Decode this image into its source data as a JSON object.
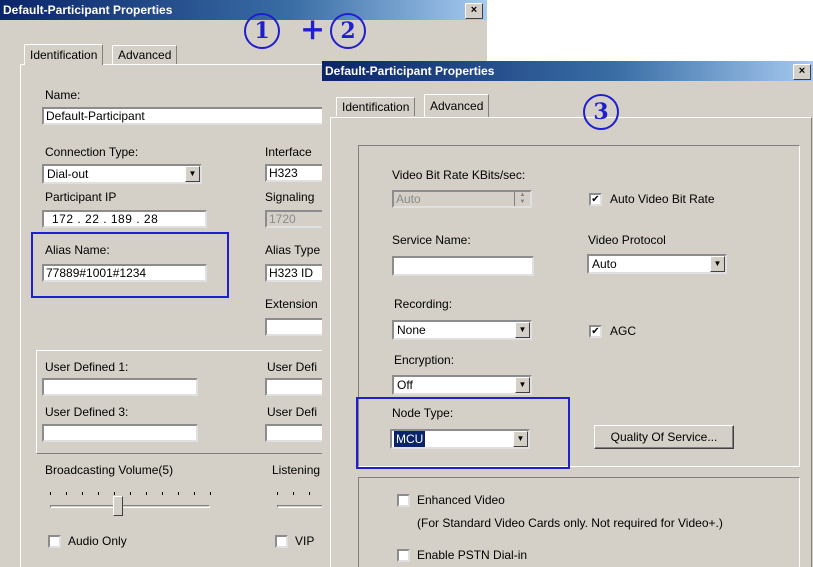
{
  "annotations": {
    "step1": "1",
    "plus": "+",
    "step2": "2",
    "step3": "3"
  },
  "left_dialog": {
    "title": "Default-Participant Properties",
    "close": "×",
    "tabs": [
      "Identification",
      "Advanced"
    ],
    "name_label": "Name:",
    "name_value": "Default-Participant",
    "connection_type_label": "Connection Type:",
    "connection_type_value": "Dial-out",
    "interface_label": "Interface",
    "interface_value": "H323",
    "participant_ip_label": "Participant IP",
    "participant_ip_value": "172 . 22 . 189 . 28",
    "signaling_label": "Signaling",
    "signaling_value": "1720",
    "alias_name_label": "Alias Name:",
    "alias_name_value": "77889#1001#1234",
    "alias_type_label": "Alias Type",
    "alias_type_value": "H323 ID",
    "extension_label": "Extension",
    "user_defined_1_label": "User Defined 1:",
    "user_defined_2_label": "User Defi",
    "user_defined_3_label": "User Defined 3:",
    "user_defined_4_label": "User Defi",
    "broadcasting_volume_label": "Broadcasting Volume(5)",
    "broadcasting_volume_level": 5,
    "listening_label": "Listening",
    "audio_only_label": "Audio Only",
    "vip_label": "VIP"
  },
  "right_dialog": {
    "title": "Default-Participant Properties",
    "close": "×",
    "tabs": [
      "Identification",
      "Advanced"
    ],
    "video_bit_rate_label": "Video Bit Rate KBits/sec:",
    "video_bit_rate_value": "Auto",
    "auto_video_bit_rate_label": "Auto Video Bit Rate",
    "auto_video_bit_rate_checked": "✔",
    "service_name_label": "Service Name:",
    "service_name_value": "",
    "video_protocol_label": "Video Protocol",
    "video_protocol_value": "Auto",
    "recording_label": "Recording:",
    "recording_value": "None",
    "agc_label": "AGC",
    "agc_checked": "✔",
    "encryption_label": "Encryption:",
    "encryption_value": "Off",
    "node_type_label": "Node Type:",
    "node_type_value": "MCU",
    "quality_of_service_button": "Quality Of Service...",
    "enhanced_video_label": "Enhanced Video",
    "enhanced_video_note": "(For Standard Video Cards only. Not required for Video+.)",
    "enable_pstn_label": "Enable PSTN Dial-in"
  },
  "icons": {
    "dropdown": "▼",
    "spin_up": "▲",
    "spin_down": "▼"
  },
  "colors": {
    "annotation": "#1f1fd0",
    "title_bar": "#0a246a",
    "dialog_bg": "#d4d0c8",
    "selection": "#0a246a"
  }
}
